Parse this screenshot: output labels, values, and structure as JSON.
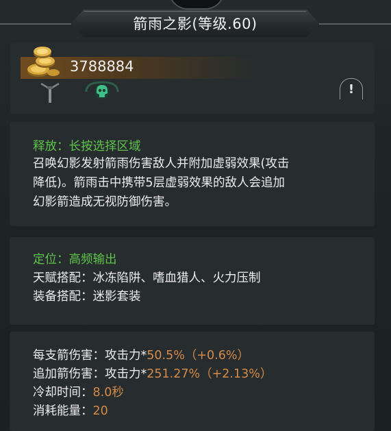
{
  "title": "箭雨之影(等级.60)",
  "currency": {
    "amount": "3788884",
    "icon": "gold-coins-icon"
  },
  "icons": {
    "weapon": "bow-weapon-icon",
    "skull": "skull-icon",
    "info": "!"
  },
  "release": {
    "heading": "释放：长按选择区域",
    "desc": [
      "召唤幻影发射箭雨伤害敌人并附加虚弱效果(攻击",
      "降低)。箭雨击中携带5层虚弱效果的敌人会追加",
      "幻影箭造成无视防御伤害。"
    ]
  },
  "role": {
    "heading": "定位：高频输出",
    "talent": "天赋搭配：冰冻陷阱、嗜血猎人、火力压制",
    "equipment": "装备搭配：迷影套装"
  },
  "stats": {
    "arrow_damage_label": "每支箭伤害：攻击力*",
    "arrow_damage_value": "50.5%（+0.6%）",
    "extra_damage_label": "追加箭伤害：攻击力*",
    "extra_damage_value": "251.27%（+2.13%）",
    "cooldown_label": "冷却时间：",
    "cooldown_value": "8.0秒",
    "energy_label": "消耗能量：",
    "energy_value": "20"
  },
  "colors": {
    "green": "#5ec24a",
    "orange": "#d48a49",
    "panel": "#272d2e"
  }
}
